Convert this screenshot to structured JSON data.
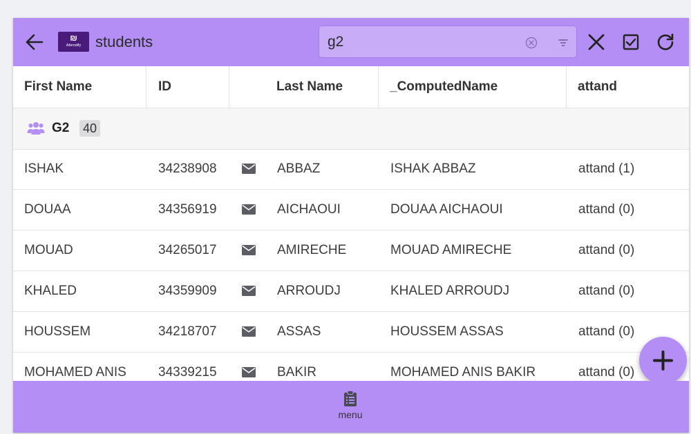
{
  "header": {
    "title": "students",
    "logo_text": "Attendify",
    "search_value": "g2"
  },
  "columns": [
    {
      "label": "First Name"
    },
    {
      "label": "ID"
    },
    {
      "label": ""
    },
    {
      "label": "Last Name"
    },
    {
      "label": "_ComputedName"
    },
    {
      "label": "attand"
    }
  ],
  "group": {
    "name": "G2",
    "count": "40"
  },
  "rows": [
    {
      "first": "ISHAK",
      "id": "34238908",
      "last": "ABBAZ",
      "computed": "ISHAK ABBAZ",
      "attand": "attand (1)"
    },
    {
      "first": "DOUAA",
      "id": "34356919",
      "last": "AICHAOUI",
      "computed": "DOUAA AICHAOUI",
      "attand": "attand (0)"
    },
    {
      "first": "MOUAD",
      "id": "34265017",
      "last": "AMIRECHE",
      "computed": "MOUAD AMIRECHE",
      "attand": "attand (0)"
    },
    {
      "first": "KHALED",
      "id": "34359909",
      "last": "ARROUDJ",
      "computed": "KHALED ARROUDJ",
      "attand": "attand (0)"
    },
    {
      "first": "HOUSSEM",
      "id": "34218707",
      "last": "ASSAS",
      "computed": "HOUSSEM ASSAS",
      "attand": "attand (0)"
    },
    {
      "first": "MOHAMED ANIS",
      "id": "34339215",
      "last": "BAKIR",
      "computed": "MOHAMED ANIS BAKIR",
      "attand": "attand (0)"
    }
  ],
  "bottom": {
    "menu_label": "menu"
  },
  "icons": {
    "back": "arrow-left-icon",
    "clear": "circle-x-icon",
    "filter": "filter-icon",
    "close": "close-icon",
    "select": "checkbox-icon",
    "refresh": "refresh-icon",
    "group": "users-icon",
    "mail": "envelope-icon",
    "add": "plus-icon",
    "menu": "clipboard-list-icon"
  },
  "colors": {
    "accent": "#b48ef5",
    "logo_bg": "#4a1a7a",
    "search_bg": "#c9acf8"
  }
}
